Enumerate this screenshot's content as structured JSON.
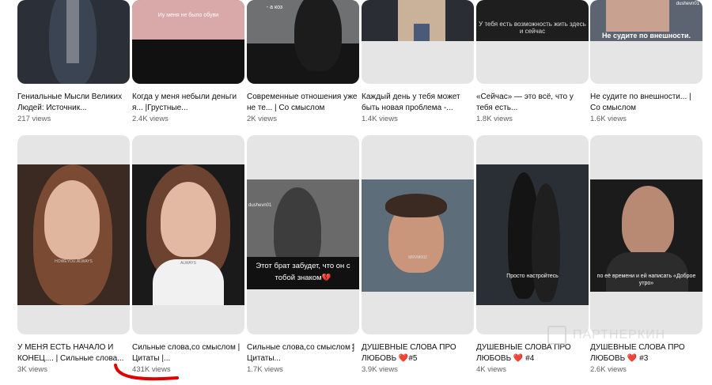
{
  "row1": [
    {
      "title": "Гениальные Мысли Великих Людей: Источник...",
      "views": "217 views",
      "overlay": ""
    },
    {
      "title": "Когда у меня небыли деньги я... |Грустные...",
      "views": "2.4K views",
      "overlay": "Иу меня не было обуви"
    },
    {
      "title": "Современные отношения уже не те... | Со смыслом",
      "views": "2K views",
      "overlay": "- а коз"
    },
    {
      "title": "Каждый день у тебя может быть новая проблема -...",
      "views": "1.4K views",
      "overlay": ""
    },
    {
      "title": "«Сейчас» — это всё, что у тебя есть...",
      "views": "1.8K views",
      "overlay": "У тебя есть возможность жить здесь и сейчас"
    },
    {
      "title": "Не судите по внешности... | Со смыслом",
      "views": "1.6K views",
      "overlay": "Не судите по внешности.",
      "channel": "dushevn01"
    }
  ],
  "row2": [
    {
      "title": "У МЕНЯ ЕСТЬ НАЧАЛО И КОНЕЦ.... | Сильные слова...",
      "views": "3K views",
      "overlay": "HOWEYOU.ALWAYS"
    },
    {
      "title": "Сильные слова,со смыслом | Цитаты |...",
      "views": "431K views",
      "overlay": "ALWAYS"
    },
    {
      "title": "Сильные слова,со смыслом | Цитаты...",
      "views": "1.7K views",
      "overlay": "Этот брат забудет, что он с тобой знаком💔",
      "channel": "dushevn01"
    },
    {
      "title": "ДУШЕВНЫЕ СЛОВА ПРО ЛЮБОВЬ ❤️#5",
      "views": "3.9K views",
      "overlay": "MRVM002"
    },
    {
      "title": "ДУШЕВНЫЕ СЛОВА ПРО ЛЮБОВЬ ❤️ #4",
      "views": "4K views",
      "overlay": "Просто настройтесь"
    },
    {
      "title": "ДУШЕВНЫЕ СЛОВА ПРО ЛЮБОВЬ ❤️ #3",
      "views": "2.6K views",
      "overlay": "по её времени и ей написать «Доброе утро»"
    }
  ],
  "watermark": "ПАРТНЕРКИН",
  "accent": "#e00000"
}
